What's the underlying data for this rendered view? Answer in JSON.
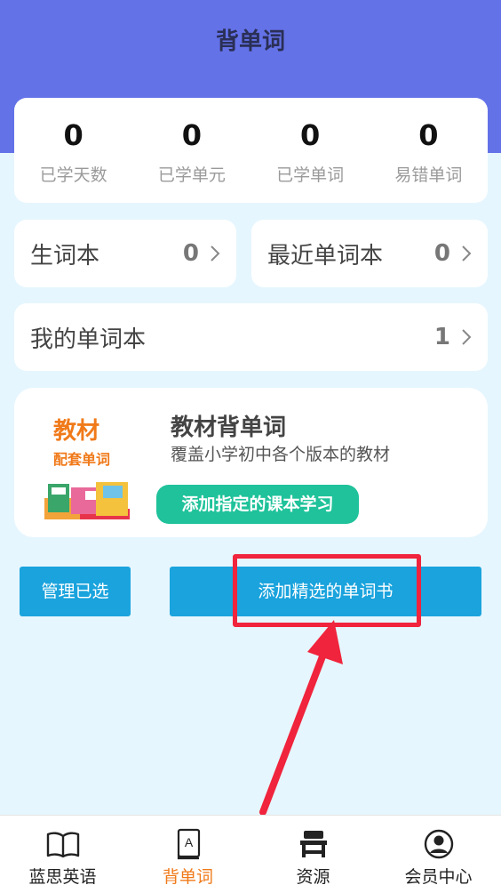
{
  "header": {
    "title": "背单词",
    "bg_color": "#6472e8"
  },
  "stats": [
    {
      "value": "0",
      "label": "已学天数"
    },
    {
      "value": "0",
      "label": "已学单元"
    },
    {
      "value": "0",
      "label": "已学单词"
    },
    {
      "value": "0",
      "label": "易错单词"
    }
  ],
  "notebooks": {
    "new_words": {
      "label": "生词本",
      "count": "0"
    },
    "recent": {
      "label": "最近单词本",
      "count": "0"
    },
    "mine": {
      "label": "我的单词本",
      "count": "1"
    }
  },
  "textbook": {
    "logo_title": "教材",
    "logo_sub": "配套单词",
    "title": "教材背单词",
    "desc": "覆盖小学初中各个版本的教材",
    "button": "添加指定的课本学习",
    "button_color": "#1fc29a"
  },
  "actions": {
    "manage": "管理已选",
    "add_book": "添加精选的单词书",
    "color": "#1aa3dd"
  },
  "annotation": {
    "color": "#f0243c"
  },
  "bottom_nav": [
    {
      "label": "蓝思英语",
      "icon": "book-open-icon"
    },
    {
      "label": "背单词",
      "icon": "word-book-icon",
      "active": true
    },
    {
      "label": "资源",
      "icon": "desk-icon"
    },
    {
      "label": "会员中心",
      "icon": "user-circle-icon"
    }
  ],
  "active_color": "#f07a1a"
}
